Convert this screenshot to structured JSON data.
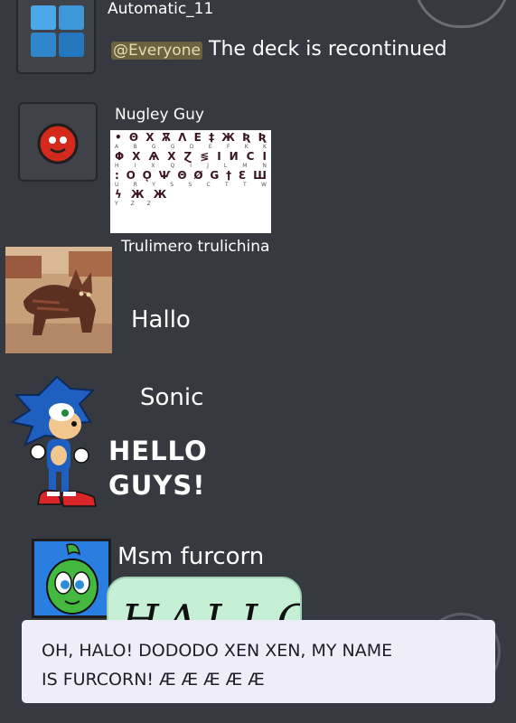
{
  "messages": [
    {
      "author": "Automatic_11",
      "mention": "@Everyone",
      "text": "The deck is recontinued"
    },
    {
      "author": "Nugley Guy",
      "alphabet": {
        "rows": [
          {
            "glyphs": [
              "•",
              "Θ",
              "Χ",
              "Ѫ",
              "Λ",
              "Ε",
              "‡",
              "Ж",
              "Ʀ",
              "Ʀ"
            ],
            "latin": [
              "A",
              "B",
              "G",
              "G",
              "D",
              "E",
              "F",
              "K",
              "K"
            ]
          },
          {
            "glyphs": [
              "Φ",
              "Ⅹ",
              "Ѧ",
              "Ⅹ",
              "Ɀ",
              "≶",
              "Ⅰ",
              "И",
              "Ⅽ",
              "Ⅰ"
            ],
            "latin": [
              "H",
              "I",
              "X",
              "Q",
              "I",
              "J",
              "L",
              "M",
              "N"
            ]
          },
          {
            "glyphs": [
              ":",
              "Ο",
              "Ǫ",
              "Ѱ",
              "Θ",
              "Ø",
              "Ǥ",
              "†",
              "Ɛ",
              "Ш"
            ],
            "latin": [
              "U",
              "R",
              "Y",
              "S",
              "S",
              "C",
              "T",
              "T",
              "W"
            ]
          },
          {
            "glyphs": [
              "ϟ",
              "Ж",
              "Ж"
            ],
            "latin": [
              "Y",
              "Z",
              "Z"
            ]
          }
        ]
      }
    },
    {
      "author": "Trulimero trulichina",
      "text": "Hallo"
    },
    {
      "author": "Sonic",
      "text_line1": "HELLO",
      "text_line2": "GUYS!"
    },
    {
      "author": "Msm furcorn",
      "bubble_text": "HALLO"
    }
  ],
  "caption": {
    "line1": "OH, HALO! DODODO XEN XEN, MY NAME",
    "line2": "IS FURCORN! Æ Æ Æ Æ Æ"
  },
  "colors": {
    "background": "#36393f",
    "mention_bg": "#6b6240",
    "caption_bg": "#efeef8",
    "bubble_bg": "#c6f0d6"
  }
}
